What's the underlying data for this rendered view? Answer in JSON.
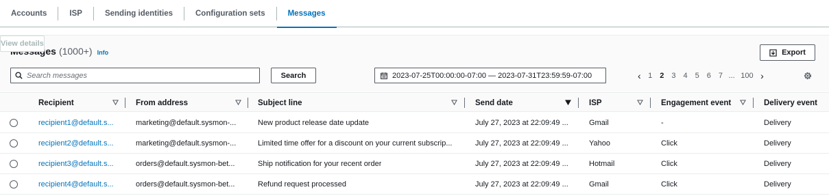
{
  "tabs": [
    {
      "label": "Accounts"
    },
    {
      "label": "ISP"
    },
    {
      "label": "Sending identities"
    },
    {
      "label": "Configuration sets"
    },
    {
      "label": "Messages"
    }
  ],
  "panel": {
    "title": "Messages",
    "count": "(1000+)",
    "info_label": "Info",
    "view_details_label": "View details",
    "export_label": "Export",
    "search": {
      "placeholder": "Search messages",
      "value": ""
    },
    "search_button": "Search",
    "date_range": "2023-07-25T00:00:00-07:00 — 2023-07-31T23:59:59-07:00",
    "pagination": {
      "pages": [
        "1",
        "2",
        "3",
        "4",
        "5",
        "6",
        "7"
      ],
      "current": "2",
      "ellipsis": "...",
      "last": "100"
    }
  },
  "table": {
    "columns": [
      "Recipient",
      "From address",
      "Subject line",
      "Send date",
      "ISP",
      "Engagement event",
      "Delivery event"
    ],
    "rows": [
      {
        "recipient": "recipient1@default.s...",
        "from": "marketing@default.sysmon-...",
        "subject": "New product release date update",
        "date": "July 27, 2023 at 22:09:49 ...",
        "isp": "Gmail",
        "engagement": "-",
        "delivery": "Delivery"
      },
      {
        "recipient": "recipient2@default.s...",
        "from": "marketing@default.sysmon-...",
        "subject": "Limited time offer for a discount on your current subscrip...",
        "date": "July 27, 2023 at 22:09:49 ...",
        "isp": "Yahoo",
        "engagement": "Click",
        "delivery": "Delivery"
      },
      {
        "recipient": "recipient3@default.s...",
        "from": "orders@default.sysmon-bet...",
        "subject": "Ship notification for your recent order",
        "date": "July 27, 2023 at 22:09:49 ...",
        "isp": "Hotmail",
        "engagement": "Click",
        "delivery": "Delivery"
      },
      {
        "recipient": "recipient4@default.s...",
        "from": "orders@default.sysmon-bet...",
        "subject": "Refund request processed",
        "date": "July 27, 2023 at 22:09:49 ...",
        "isp": "Gmail",
        "engagement": "Click",
        "delivery": "Delivery"
      }
    ]
  },
  "icons": {
    "search": "search-icon",
    "calendar": "calendar-icon",
    "export": "download-icon",
    "settings": "gear-icon",
    "sort": "caret-down-icon"
  },
  "colors": {
    "link": "#0073bb",
    "text": "#16191f",
    "muted": "#545b64"
  }
}
